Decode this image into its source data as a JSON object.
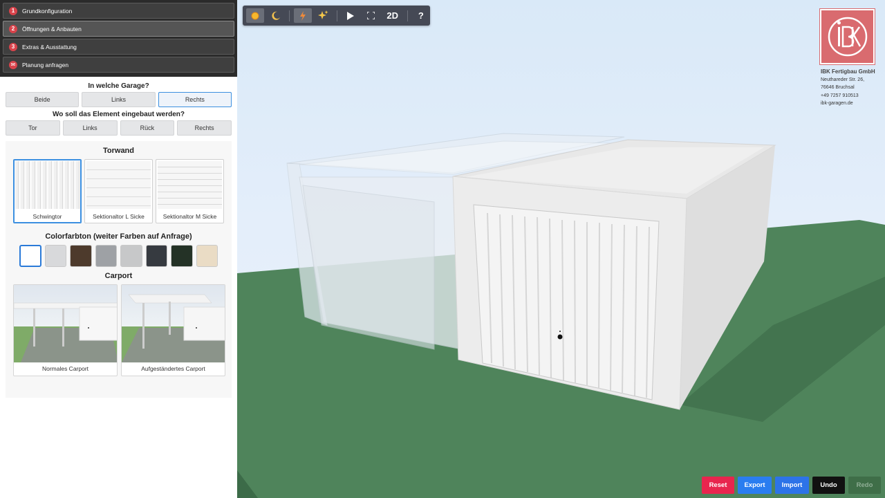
{
  "steps": [
    {
      "num": "1",
      "label": "Grundkonfiguration"
    },
    {
      "num": "2",
      "label": "Öffnungen & Anbauten"
    },
    {
      "num": "3",
      "label": "Extras & Ausstattung"
    },
    {
      "num": "✉",
      "label": "Planung anfragen"
    }
  ],
  "garage_question": "In welche Garage?",
  "garage_options": [
    "Beide",
    "Links",
    "Rechts"
  ],
  "position_question": "Wo soll das Element eingebaut werden?",
  "position_options": [
    "Tor",
    "Links",
    "Rück",
    "Rechts"
  ],
  "torwand": {
    "title": "Torwand",
    "options": [
      "Schwingtor",
      "Sektionaltor L Sicke",
      "Sektionaltor M Sicke"
    ]
  },
  "colors": {
    "title": "Colorfarbton (weiter Farben auf Anfrage)",
    "swatches": [
      "#ffffff",
      "#d8d9db",
      "#4d3a2c",
      "#9ea1a5",
      "#c7c8c9",
      "#363a40",
      "#243226",
      "#eadcc5"
    ]
  },
  "carport": {
    "title": "Carport",
    "options": [
      "Normales Carport",
      "Aufgeständertes Carport"
    ]
  },
  "toolbar": {
    "view2d": "2D",
    "help": "?"
  },
  "company": {
    "name": "IBK Fertigbau GmbH",
    "street": "Neuthareder Str. 26,",
    "city": "76646 Bruchsal",
    "phone": "+49 7257 910513",
    "web": "ibk-garagen.de"
  },
  "buttons": {
    "reset": "Reset",
    "export": "Export",
    "import": "Import",
    "undo": "Undo",
    "redo": "Redo"
  },
  "accent": {
    "red": "#e8254e",
    "blue": "#2a7df0",
    "blue2": "#2d73e8",
    "dark": "#111111",
    "green": "#3f6e48"
  }
}
